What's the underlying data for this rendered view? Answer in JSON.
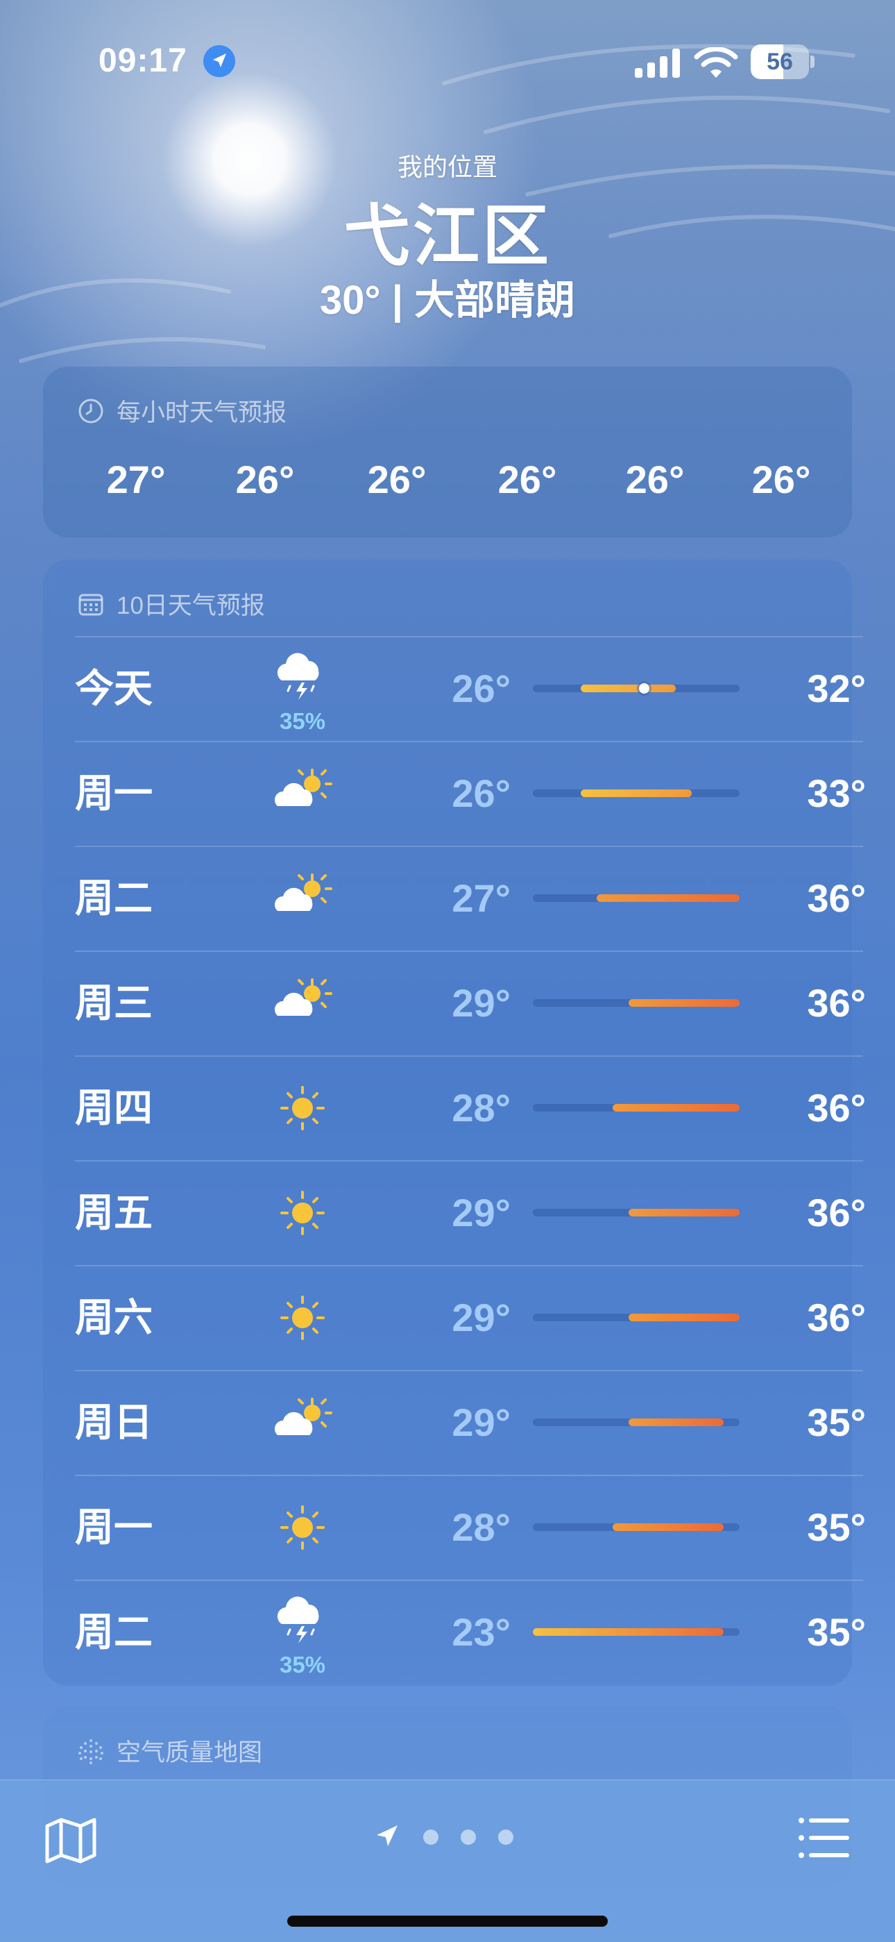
{
  "status_bar": {
    "time": "09:17",
    "battery": "56",
    "battery_level": 0.56
  },
  "header": {
    "my_location": "我的位置",
    "city": "弋江区",
    "current": "30° | 大部晴朗"
  },
  "hourly": {
    "title": "每小时天气预报",
    "temps": [
      "27°",
      "26°",
      "26°",
      "26°",
      "26°",
      "26°"
    ]
  },
  "ten_day": {
    "title": "10日天气预报",
    "scale_min": 23,
    "scale_max": 36,
    "days": [
      {
        "day": "今天",
        "icon": "thunderstorm-icon",
        "precip": "35%",
        "low": "26°",
        "high": "32°",
        "low_val": 26,
        "high_val": 32,
        "current_val": 30
      },
      {
        "day": "周一",
        "icon": "partly-sunny-icon",
        "precip": "",
        "low": "26°",
        "high": "33°",
        "low_val": 26,
        "high_val": 33
      },
      {
        "day": "周二",
        "icon": "partly-sunny-icon",
        "precip": "",
        "low": "27°",
        "high": "36°",
        "low_val": 27,
        "high_val": 36
      },
      {
        "day": "周三",
        "icon": "partly-sunny-icon",
        "precip": "",
        "low": "29°",
        "high": "36°",
        "low_val": 29,
        "high_val": 36
      },
      {
        "day": "周四",
        "icon": "sun-icon",
        "precip": "",
        "low": "28°",
        "high": "36°",
        "low_val": 28,
        "high_val": 36
      },
      {
        "day": "周五",
        "icon": "sun-icon",
        "precip": "",
        "low": "29°",
        "high": "36°",
        "low_val": 29,
        "high_val": 36
      },
      {
        "day": "周六",
        "icon": "sun-icon",
        "precip": "",
        "low": "29°",
        "high": "36°",
        "low_val": 29,
        "high_val": 36
      },
      {
        "day": "周日",
        "icon": "partly-sunny-icon",
        "precip": "",
        "low": "29°",
        "high": "35°",
        "low_val": 29,
        "high_val": 35
      },
      {
        "day": "周一",
        "icon": "sun-icon",
        "precip": "",
        "low": "28°",
        "high": "35°",
        "low_val": 28,
        "high_val": 35
      },
      {
        "day": "周二",
        "icon": "thunderstorm-icon",
        "precip": "35%",
        "low": "23°",
        "high": "35°",
        "low_val": 23,
        "high_val": 35
      }
    ]
  },
  "air_quality": {
    "title": "空气质量地图"
  },
  "bottom_bar": {
    "page_count": 3,
    "current_page": "location"
  },
  "colors": {
    "precip": "#8fd3ff",
    "temp_cool": "#f5c140",
    "temp_warm": "#f19a3a",
    "temp_hot": "#ee6a35"
  }
}
